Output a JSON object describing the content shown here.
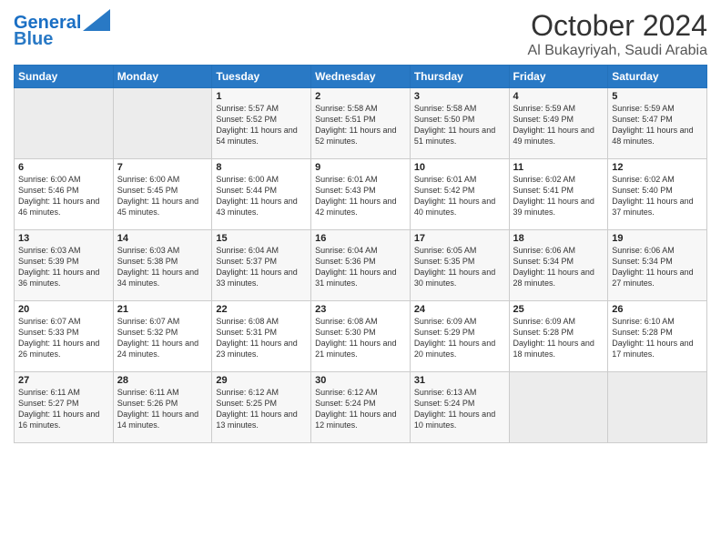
{
  "logo": {
    "line1": "General",
    "line2": "Blue"
  },
  "header": {
    "month": "October 2024",
    "location": "Al Bukayriyah, Saudi Arabia"
  },
  "weekdays": [
    "Sunday",
    "Monday",
    "Tuesday",
    "Wednesday",
    "Thursday",
    "Friday",
    "Saturday"
  ],
  "weeks": [
    [
      {
        "day": "",
        "sunrise": "",
        "sunset": "",
        "daylight": ""
      },
      {
        "day": "",
        "sunrise": "",
        "sunset": "",
        "daylight": ""
      },
      {
        "day": "1",
        "sunrise": "Sunrise: 5:57 AM",
        "sunset": "Sunset: 5:52 PM",
        "daylight": "Daylight: 11 hours and 54 minutes."
      },
      {
        "day": "2",
        "sunrise": "Sunrise: 5:58 AM",
        "sunset": "Sunset: 5:51 PM",
        "daylight": "Daylight: 11 hours and 52 minutes."
      },
      {
        "day": "3",
        "sunrise": "Sunrise: 5:58 AM",
        "sunset": "Sunset: 5:50 PM",
        "daylight": "Daylight: 11 hours and 51 minutes."
      },
      {
        "day": "4",
        "sunrise": "Sunrise: 5:59 AM",
        "sunset": "Sunset: 5:49 PM",
        "daylight": "Daylight: 11 hours and 49 minutes."
      },
      {
        "day": "5",
        "sunrise": "Sunrise: 5:59 AM",
        "sunset": "Sunset: 5:47 PM",
        "daylight": "Daylight: 11 hours and 48 minutes."
      }
    ],
    [
      {
        "day": "6",
        "sunrise": "Sunrise: 6:00 AM",
        "sunset": "Sunset: 5:46 PM",
        "daylight": "Daylight: 11 hours and 46 minutes."
      },
      {
        "day": "7",
        "sunrise": "Sunrise: 6:00 AM",
        "sunset": "Sunset: 5:45 PM",
        "daylight": "Daylight: 11 hours and 45 minutes."
      },
      {
        "day": "8",
        "sunrise": "Sunrise: 6:00 AM",
        "sunset": "Sunset: 5:44 PM",
        "daylight": "Daylight: 11 hours and 43 minutes."
      },
      {
        "day": "9",
        "sunrise": "Sunrise: 6:01 AM",
        "sunset": "Sunset: 5:43 PM",
        "daylight": "Daylight: 11 hours and 42 minutes."
      },
      {
        "day": "10",
        "sunrise": "Sunrise: 6:01 AM",
        "sunset": "Sunset: 5:42 PM",
        "daylight": "Daylight: 11 hours and 40 minutes."
      },
      {
        "day": "11",
        "sunrise": "Sunrise: 6:02 AM",
        "sunset": "Sunset: 5:41 PM",
        "daylight": "Daylight: 11 hours and 39 minutes."
      },
      {
        "day": "12",
        "sunrise": "Sunrise: 6:02 AM",
        "sunset": "Sunset: 5:40 PM",
        "daylight": "Daylight: 11 hours and 37 minutes."
      }
    ],
    [
      {
        "day": "13",
        "sunrise": "Sunrise: 6:03 AM",
        "sunset": "Sunset: 5:39 PM",
        "daylight": "Daylight: 11 hours and 36 minutes."
      },
      {
        "day": "14",
        "sunrise": "Sunrise: 6:03 AM",
        "sunset": "Sunset: 5:38 PM",
        "daylight": "Daylight: 11 hours and 34 minutes."
      },
      {
        "day": "15",
        "sunrise": "Sunrise: 6:04 AM",
        "sunset": "Sunset: 5:37 PM",
        "daylight": "Daylight: 11 hours and 33 minutes."
      },
      {
        "day": "16",
        "sunrise": "Sunrise: 6:04 AM",
        "sunset": "Sunset: 5:36 PM",
        "daylight": "Daylight: 11 hours and 31 minutes."
      },
      {
        "day": "17",
        "sunrise": "Sunrise: 6:05 AM",
        "sunset": "Sunset: 5:35 PM",
        "daylight": "Daylight: 11 hours and 30 minutes."
      },
      {
        "day": "18",
        "sunrise": "Sunrise: 6:06 AM",
        "sunset": "Sunset: 5:34 PM",
        "daylight": "Daylight: 11 hours and 28 minutes."
      },
      {
        "day": "19",
        "sunrise": "Sunrise: 6:06 AM",
        "sunset": "Sunset: 5:34 PM",
        "daylight": "Daylight: 11 hours and 27 minutes."
      }
    ],
    [
      {
        "day": "20",
        "sunrise": "Sunrise: 6:07 AM",
        "sunset": "Sunset: 5:33 PM",
        "daylight": "Daylight: 11 hours and 26 minutes."
      },
      {
        "day": "21",
        "sunrise": "Sunrise: 6:07 AM",
        "sunset": "Sunset: 5:32 PM",
        "daylight": "Daylight: 11 hours and 24 minutes."
      },
      {
        "day": "22",
        "sunrise": "Sunrise: 6:08 AM",
        "sunset": "Sunset: 5:31 PM",
        "daylight": "Daylight: 11 hours and 23 minutes."
      },
      {
        "day": "23",
        "sunrise": "Sunrise: 6:08 AM",
        "sunset": "Sunset: 5:30 PM",
        "daylight": "Daylight: 11 hours and 21 minutes."
      },
      {
        "day": "24",
        "sunrise": "Sunrise: 6:09 AM",
        "sunset": "Sunset: 5:29 PM",
        "daylight": "Daylight: 11 hours and 20 minutes."
      },
      {
        "day": "25",
        "sunrise": "Sunrise: 6:09 AM",
        "sunset": "Sunset: 5:28 PM",
        "daylight": "Daylight: 11 hours and 18 minutes."
      },
      {
        "day": "26",
        "sunrise": "Sunrise: 6:10 AM",
        "sunset": "Sunset: 5:28 PM",
        "daylight": "Daylight: 11 hours and 17 minutes."
      }
    ],
    [
      {
        "day": "27",
        "sunrise": "Sunrise: 6:11 AM",
        "sunset": "Sunset: 5:27 PM",
        "daylight": "Daylight: 11 hours and 16 minutes."
      },
      {
        "day": "28",
        "sunrise": "Sunrise: 6:11 AM",
        "sunset": "Sunset: 5:26 PM",
        "daylight": "Daylight: 11 hours and 14 minutes."
      },
      {
        "day": "29",
        "sunrise": "Sunrise: 6:12 AM",
        "sunset": "Sunset: 5:25 PM",
        "daylight": "Daylight: 11 hours and 13 minutes."
      },
      {
        "day": "30",
        "sunrise": "Sunrise: 6:12 AM",
        "sunset": "Sunset: 5:24 PM",
        "daylight": "Daylight: 11 hours and 12 minutes."
      },
      {
        "day": "31",
        "sunrise": "Sunrise: 6:13 AM",
        "sunset": "Sunset: 5:24 PM",
        "daylight": "Daylight: 11 hours and 10 minutes."
      },
      {
        "day": "",
        "sunrise": "",
        "sunset": "",
        "daylight": ""
      },
      {
        "day": "",
        "sunrise": "",
        "sunset": "",
        "daylight": ""
      }
    ]
  ]
}
